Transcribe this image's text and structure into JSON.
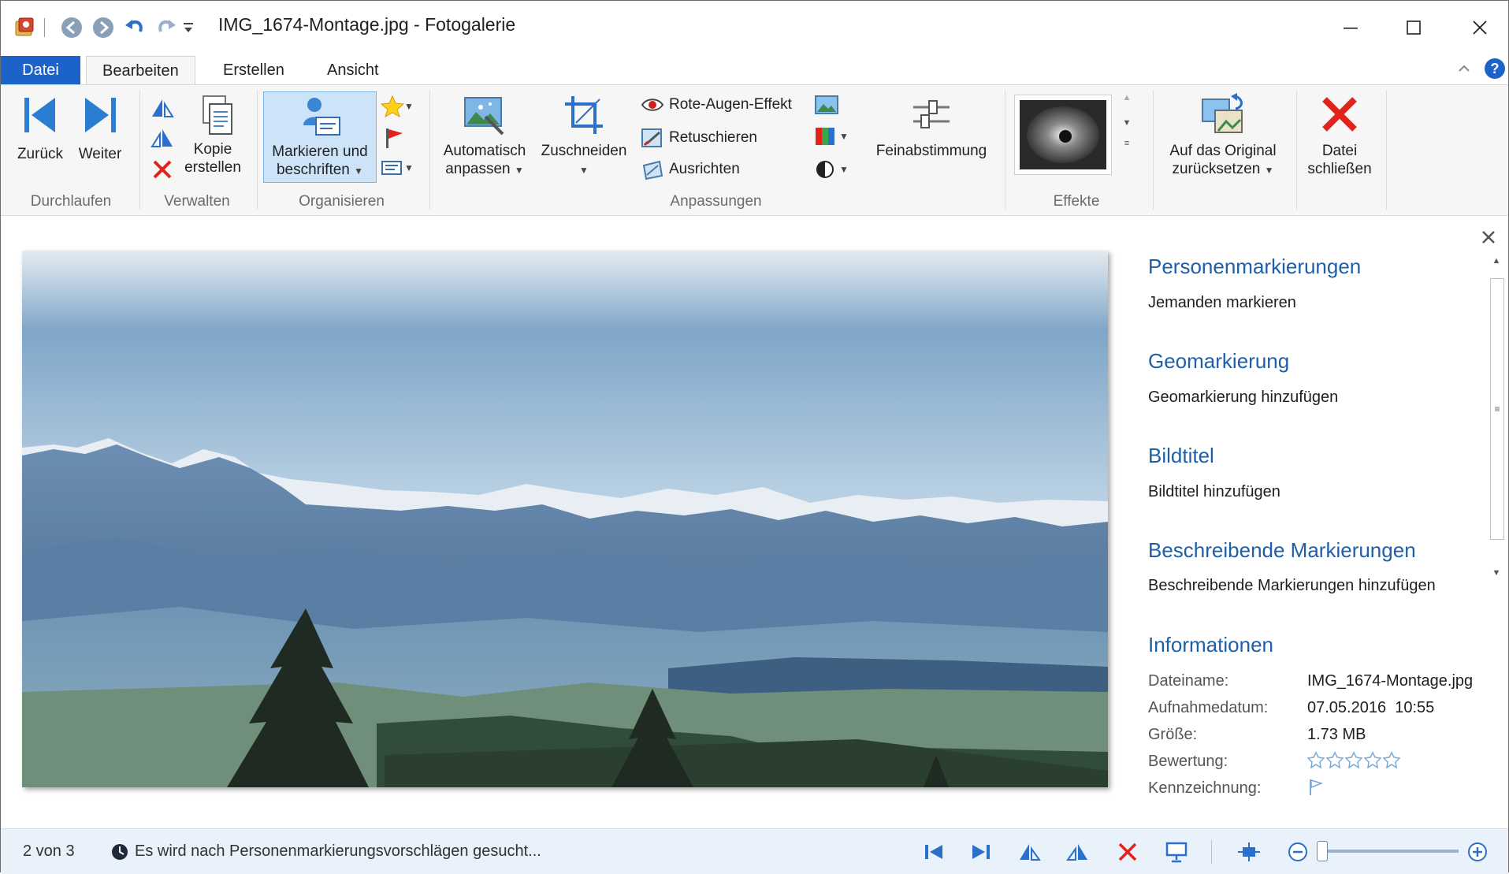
{
  "window": {
    "title": "IMG_1674-Montage.jpg - Fotogalerie",
    "controls": {
      "minimize": "minimize",
      "maximize": "maximize",
      "close": "close"
    }
  },
  "quick_access": [
    "app-icon",
    "back-icon",
    "forward-icon",
    "undo-icon",
    "redo-icon",
    "customize-icon"
  ],
  "tabs": [
    {
      "label": "Datei",
      "state": "file"
    },
    {
      "label": "Bearbeiten",
      "state": "active"
    },
    {
      "label": "Erstellen",
      "state": "normal"
    },
    {
      "label": "Ansicht",
      "state": "normal"
    }
  ],
  "ribbon": {
    "durchlaufen": {
      "label": "Durchlaufen",
      "back": "Zurück",
      "next": "Weiter"
    },
    "verwalten": {
      "label": "Verwalten",
      "copy_line1": "Kopie",
      "copy_line2": "erstellen"
    },
    "organisieren": {
      "label": "Organisieren",
      "tag_line1": "Markieren und",
      "tag_line2": "beschriften"
    },
    "anpassungen": {
      "label": "Anpassungen",
      "auto_line1": "Automatisch",
      "auto_line2": "anpassen",
      "crop": "Zuschneiden",
      "red_eye": "Rote-Augen-Effekt",
      "retouch": "Retuschieren",
      "straighten": "Ausrichten",
      "fine_tune": "Feinabstimmung"
    },
    "effekte": {
      "label": "Effekte"
    },
    "revert": {
      "line1": "Auf das Original",
      "line2": "zurücksetzen"
    },
    "close_file": {
      "line1": "Datei",
      "line2": "schließen"
    }
  },
  "pane": {
    "people_heading": "Personenmarkierungen",
    "people_link": "Jemanden markieren",
    "geo_heading": "Geomarkierung",
    "geo_link": "Geomarkierung hinzufügen",
    "caption_heading": "Bildtitel",
    "caption_link": "Bildtitel hinzufügen",
    "desc_heading": "Beschreibende Markierungen",
    "desc_link": "Beschreibende Markierungen hinzufügen",
    "info_heading": "Informationen",
    "info": [
      {
        "key": "Dateiname:",
        "value": "IMG_1674-Montage.jpg"
      },
      {
        "key": "Aufnahmedatum:",
        "value": "07.05.2016  10:55"
      },
      {
        "key": "Größe:",
        "value": "1.73 MB"
      },
      {
        "key": "Bewertung:",
        "value": ""
      },
      {
        "key": "Kennzeichnung:",
        "value": ""
      }
    ],
    "rating_stars": 0
  },
  "status": {
    "position": "2 von 3",
    "message": "Es wird nach Personenmarkierungsvorschlägen gesucht...",
    "zoom_level": 0
  },
  "colors": {
    "accent": "#1b63c8",
    "heading": "#1f5fa8",
    "status_bg": "#e9f1fb",
    "delete_red": "#e0241b"
  }
}
